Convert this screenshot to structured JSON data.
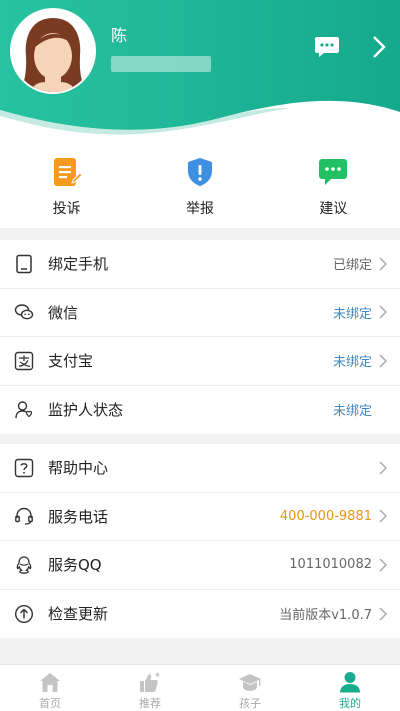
{
  "colors": {
    "accent": "#1aac8e",
    "link_blue": "#3f88c5",
    "phone_orange": "#e8960f"
  },
  "profile": {
    "name": "陈"
  },
  "actions": [
    {
      "label": "投诉",
      "icon": "complaint-icon"
    },
    {
      "label": "举报",
      "icon": "report-shield-icon"
    },
    {
      "label": "建议",
      "icon": "suggestion-chat-icon"
    }
  ],
  "account": [
    {
      "label": "绑定手机",
      "value": "已绑定",
      "icon": "phone-icon"
    },
    {
      "label": "微信",
      "value": "未绑定",
      "icon": "wechat-icon"
    },
    {
      "label": "支付宝",
      "value": "未绑定",
      "icon": "alipay-icon"
    },
    {
      "label": "监护人状态",
      "value": "未绑定",
      "icon": "guardian-icon"
    }
  ],
  "support": [
    {
      "label": "帮助中心",
      "value": "",
      "icon": "help-icon"
    },
    {
      "label": "服务电话",
      "value": "400-000-9881",
      "icon": "headset-icon"
    },
    {
      "label": "服务QQ",
      "value": "1011010082",
      "icon": "qq-icon"
    },
    {
      "label": "检查更新",
      "value": "当前版本v1.0.7",
      "icon": "update-icon"
    }
  ],
  "tabs": [
    {
      "label": "首页",
      "icon": "home-icon"
    },
    {
      "label": "推荐",
      "icon": "recommend-icon"
    },
    {
      "label": "孩子",
      "icon": "child-icon"
    },
    {
      "label": "我的",
      "icon": "profile-icon"
    }
  ]
}
